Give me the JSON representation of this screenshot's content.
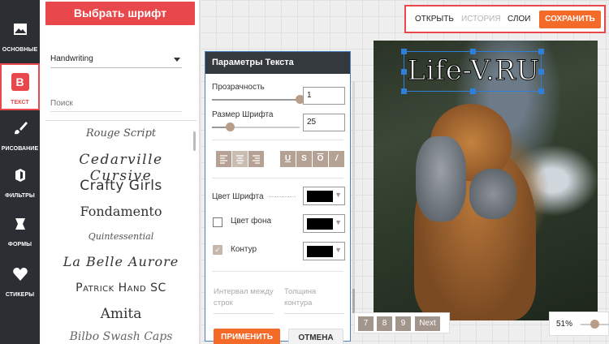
{
  "toolbar": {
    "items": [
      {
        "label": "ОСНОВНЫЕ",
        "icon": "image-icon"
      },
      {
        "label": "ТЕКСТ",
        "icon": "text-b-icon",
        "glyph": "B"
      },
      {
        "label": "РИСОВАНИЕ",
        "icon": "brush-icon"
      },
      {
        "label": "ФИЛЬТРЫ",
        "icon": "filter-icon"
      },
      {
        "label": "ФОРМЫ",
        "icon": "shape-icon"
      },
      {
        "label": "СТИКЕРЫ",
        "icon": "heart-icon"
      }
    ]
  },
  "font_panel": {
    "pick_font_label": "Выбрать шрифт",
    "category_value": "Handwriting",
    "search_placeholder": "Поиск",
    "fonts": [
      "Rouge Script",
      "Cedarville Cursive",
      "Crafty Girls",
      "Fondamento",
      "Quintessential",
      "La Belle Aurore",
      "Patrick Hand SC",
      "Amita",
      "Bilbo Swash Caps"
    ]
  },
  "actionbar": {
    "open_label": "ОТКРЫТЬ",
    "history_label": "ИСТОРИЯ",
    "layers_label": "СЛОИ",
    "save_label": "СОХРАНИТЬ"
  },
  "params": {
    "title": "Параметры Текста",
    "opacity_label": "Прозрачность",
    "opacity_value": "1",
    "opacity_level": 1.0,
    "font_size_label": "Размер Шрифта",
    "font_size_value": "25",
    "font_size_level": 0.2,
    "align_buttons": [
      "align-left",
      "align-center",
      "align-right"
    ],
    "style_buttons": [
      "U",
      "S",
      "O",
      "/"
    ],
    "font_color_label": "Цвет Шрифта",
    "font_color": "#000000",
    "bg_color_label": "Цвет фона",
    "bg_color": "#000000",
    "bg_checked": false,
    "outline_label": "Контур",
    "outline_color": "#000000",
    "outline_checked": true,
    "line_spacing_hint": "Интервал между строк",
    "outline_width_hint": "Толщина контура",
    "apply_label": "ПРИМЕНИТЬ",
    "cancel_label": "ОТМЕНА"
  },
  "canvas": {
    "overlay_text": "Life-V.RU"
  },
  "pager": {
    "pages": [
      "7",
      "8",
      "9"
    ],
    "next_label": "Next"
  },
  "zoom": {
    "value": "51%",
    "level": 0.51
  },
  "colors": {
    "accent_red": "#e8474b",
    "accent_orange": "#f46a28",
    "toolbar_bg": "#2b2f33",
    "panel_header": "#34393e",
    "selection_blue": "#2f7ed8"
  }
}
